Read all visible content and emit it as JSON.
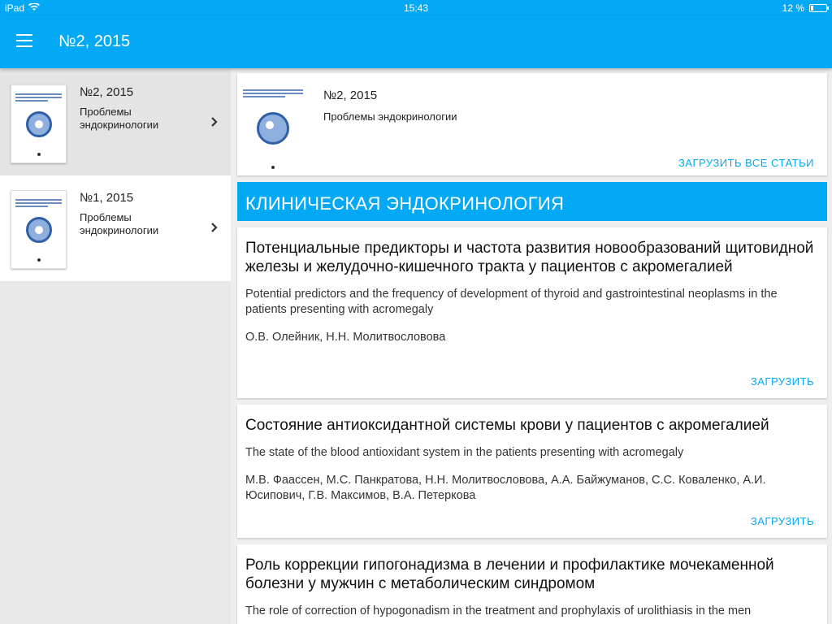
{
  "status_bar": {
    "device": "iPad",
    "time": "15:43",
    "battery": "12 %"
  },
  "app_bar": {
    "title": "№2, 2015"
  },
  "issues": [
    {
      "number": "№2, 2015",
      "journal": "Проблемы эндокринологии"
    },
    {
      "number": "№1, 2015",
      "journal": "Проблемы эндокринологии"
    }
  ],
  "current_issue": {
    "number": "№2, 2015",
    "journal": "Проблемы эндокринологии",
    "download_all": "ЗАГРУЗИТЬ ВСЕ СТАТЬИ"
  },
  "section": {
    "title": "КЛИНИЧЕСКАЯ ЭНДОКРИНОЛОГИЯ"
  },
  "articles": [
    {
      "title": "Потенциальные предикторы и частота развития новообразований щитовидной железы и желудочно-кишечного тракта у пациентов с акромегалией",
      "title_en": "Potential predictors and the frequency of development of thyroid and gastrointestinal neoplasms in the patients presenting with acromegaly",
      "authors": "О.В. Олейник, Н.Н. Молитвословова",
      "download": "ЗАГРУЗИТЬ"
    },
    {
      "title": "Состояние антиоксидантной системы крови у пациентов с акромегалией",
      "title_en": "The state of the blood antioxidant system in the patients presenting with acromegaly",
      "authors": "М.В. Фаассен, М.С. Панкратова, Н.Н. Молитвословова, А.А. Байжуманов, С.С. Коваленко, А.И. Юсипович, Г.В. Максимов, В.А. Петеркова",
      "download": "ЗАГРУЗИТЬ"
    },
    {
      "title": "Роль коррекции гипогонадизма в лечении и профилактике мочекаменной болезни у мужчин с метаболическим синдромом",
      "title_en": "The role of correction of hypogonadism in the treatment and prophylaxis of urolithiasis in the men"
    }
  ],
  "colors": {
    "accent": "#03a9f4"
  }
}
